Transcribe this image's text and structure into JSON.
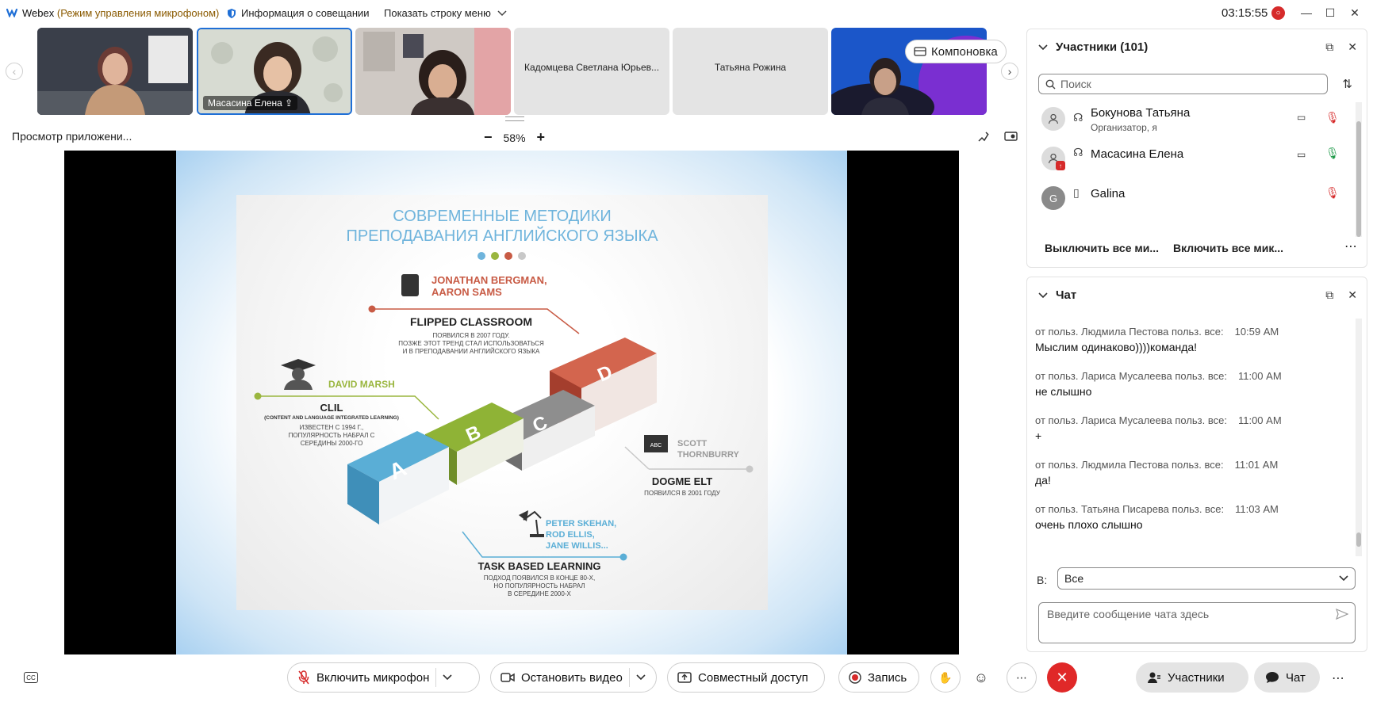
{
  "titlebar": {
    "app_name": "Webex",
    "app_mode": "(Режим управления микрофоном)",
    "meeting_info": "Информация о совещании",
    "show_menu": "Показать строку меню",
    "clock": "03:15:55"
  },
  "strip": {
    "tiles": [
      {
        "name": "",
        "type": "video"
      },
      {
        "name": "Масасина Елена",
        "type": "video"
      },
      {
        "name": "",
        "type": "video"
      },
      {
        "name": "Кадомцева Светлана Юрьев...",
        "type": "name"
      },
      {
        "name": "Татьяна Рожина",
        "type": "name"
      },
      {
        "name": "",
        "type": "video"
      }
    ],
    "layout_button": "Компоновка"
  },
  "share": {
    "app_view": "Просмотр приложени...",
    "zoom": "58%"
  },
  "slide": {
    "title_line1": "СОВРЕМЕННЫЕ МЕТОДИКИ",
    "title_line2": "ПРЕПОДАВАНИЯ АНГЛИЙСКОГО ЯЗЫКА",
    "book_letters": [
      "A",
      "B",
      "C",
      "D"
    ],
    "blocks": {
      "flipped": {
        "authors1": "JONATHAN BERGMAN,",
        "authors2": "AARON SAMS",
        "name": "FLIPPED CLASSROOM",
        "desc1": "ПОЯВИЛСЯ В 2007 ГОДУ.",
        "desc2": "ПОЗЖЕ ЭТОТ ТРЕНД СТАЛ ИСПОЛЬЗОВАТЬСЯ",
        "desc3": "И В ПРЕПОДАВАНИИ АНГЛИЙСКОГО ЯЗЫКА"
      },
      "clil": {
        "author": "DAVID MARSH",
        "name": "CLIL",
        "sub": "(CONTENT AND LANGUAGE INTEGRATED LEARNING)",
        "desc1": "ИЗВЕСТЕН С 1994 Г.,",
        "desc2": "ПОПУЛЯРНОСТЬ НАБРАЛ С",
        "desc3": "СЕРЕДИНЫ 2000-ГО"
      },
      "dogme": {
        "board": "ABC",
        "author1": "SCOTT",
        "author2": "THORNBURRY",
        "name": "DOGME ELT",
        "desc": "ПОЯВИЛСЯ В 2001 ГОДУ"
      },
      "tbl": {
        "author1": "PETER SKEHAN,",
        "author2": "ROD ELLIS,",
        "author3": "JANE WILLIS...",
        "name": "TASK BASED LEARNING",
        "desc1": "ПОДХОД ПОЯВИЛСЯ В КОНЦЕ 80-Х,",
        "desc2": "НО ПОПУЛЯРНОСТЬ НАБРАЛ",
        "desc3": "В СЕРЕДИНЕ 2000-Х"
      }
    }
  },
  "participants": {
    "title": "Участники (101)",
    "search_placeholder": "Поиск",
    "rows": [
      {
        "name": "Бокунова Татьяна",
        "role": "Организатор, я",
        "avatar": ""
      },
      {
        "name": "Масасина Елена",
        "role": "",
        "avatar": ""
      },
      {
        "name": "Galina",
        "role": "",
        "avatar": "G"
      }
    ],
    "mute_all": "Выключить все ми...",
    "unmute_all": "Включить все мик..."
  },
  "chat": {
    "title": "Чат",
    "messages": [
      {
        "meta": "от польз. Людмила Пестова польз. все:",
        "time": "10:59 AM",
        "text": "Мыслим одинаково))))команда!"
      },
      {
        "meta": "от польз. Лариса Мусалеева польз. все:",
        "time": "11:00 AM",
        "text": "не слышно"
      },
      {
        "meta": "от польз. Лариса Мусалеева польз. все:",
        "time": "11:00 AM",
        "text": "+"
      },
      {
        "meta": "от польз. Людмила Пестова польз. все:",
        "time": "11:01 AM",
        "text": "да!"
      },
      {
        "meta": "от польз. Татьяна Писарева польз. все:",
        "time": "11:03 AM",
        "text": "очень плохо слышно"
      }
    ],
    "to_label": "В:",
    "to_value": "Все",
    "input_placeholder": "Введите сообщение чата здесь"
  },
  "toolbar": {
    "mic": "Включить микрофон",
    "video": "Остановить видео",
    "share": "Совместный доступ",
    "record": "Запись",
    "participants": "Участники",
    "chat": "Чат"
  },
  "colors": {
    "accent_blue": "#1f6fd6",
    "end_red": "#e02828",
    "muted_red": "#d62b2b",
    "slide_title": "#6fb4dc",
    "flipped_accent": "#c85b45",
    "clil_accent": "#9ab63f",
    "tbl_accent": "#5aaed6"
  }
}
